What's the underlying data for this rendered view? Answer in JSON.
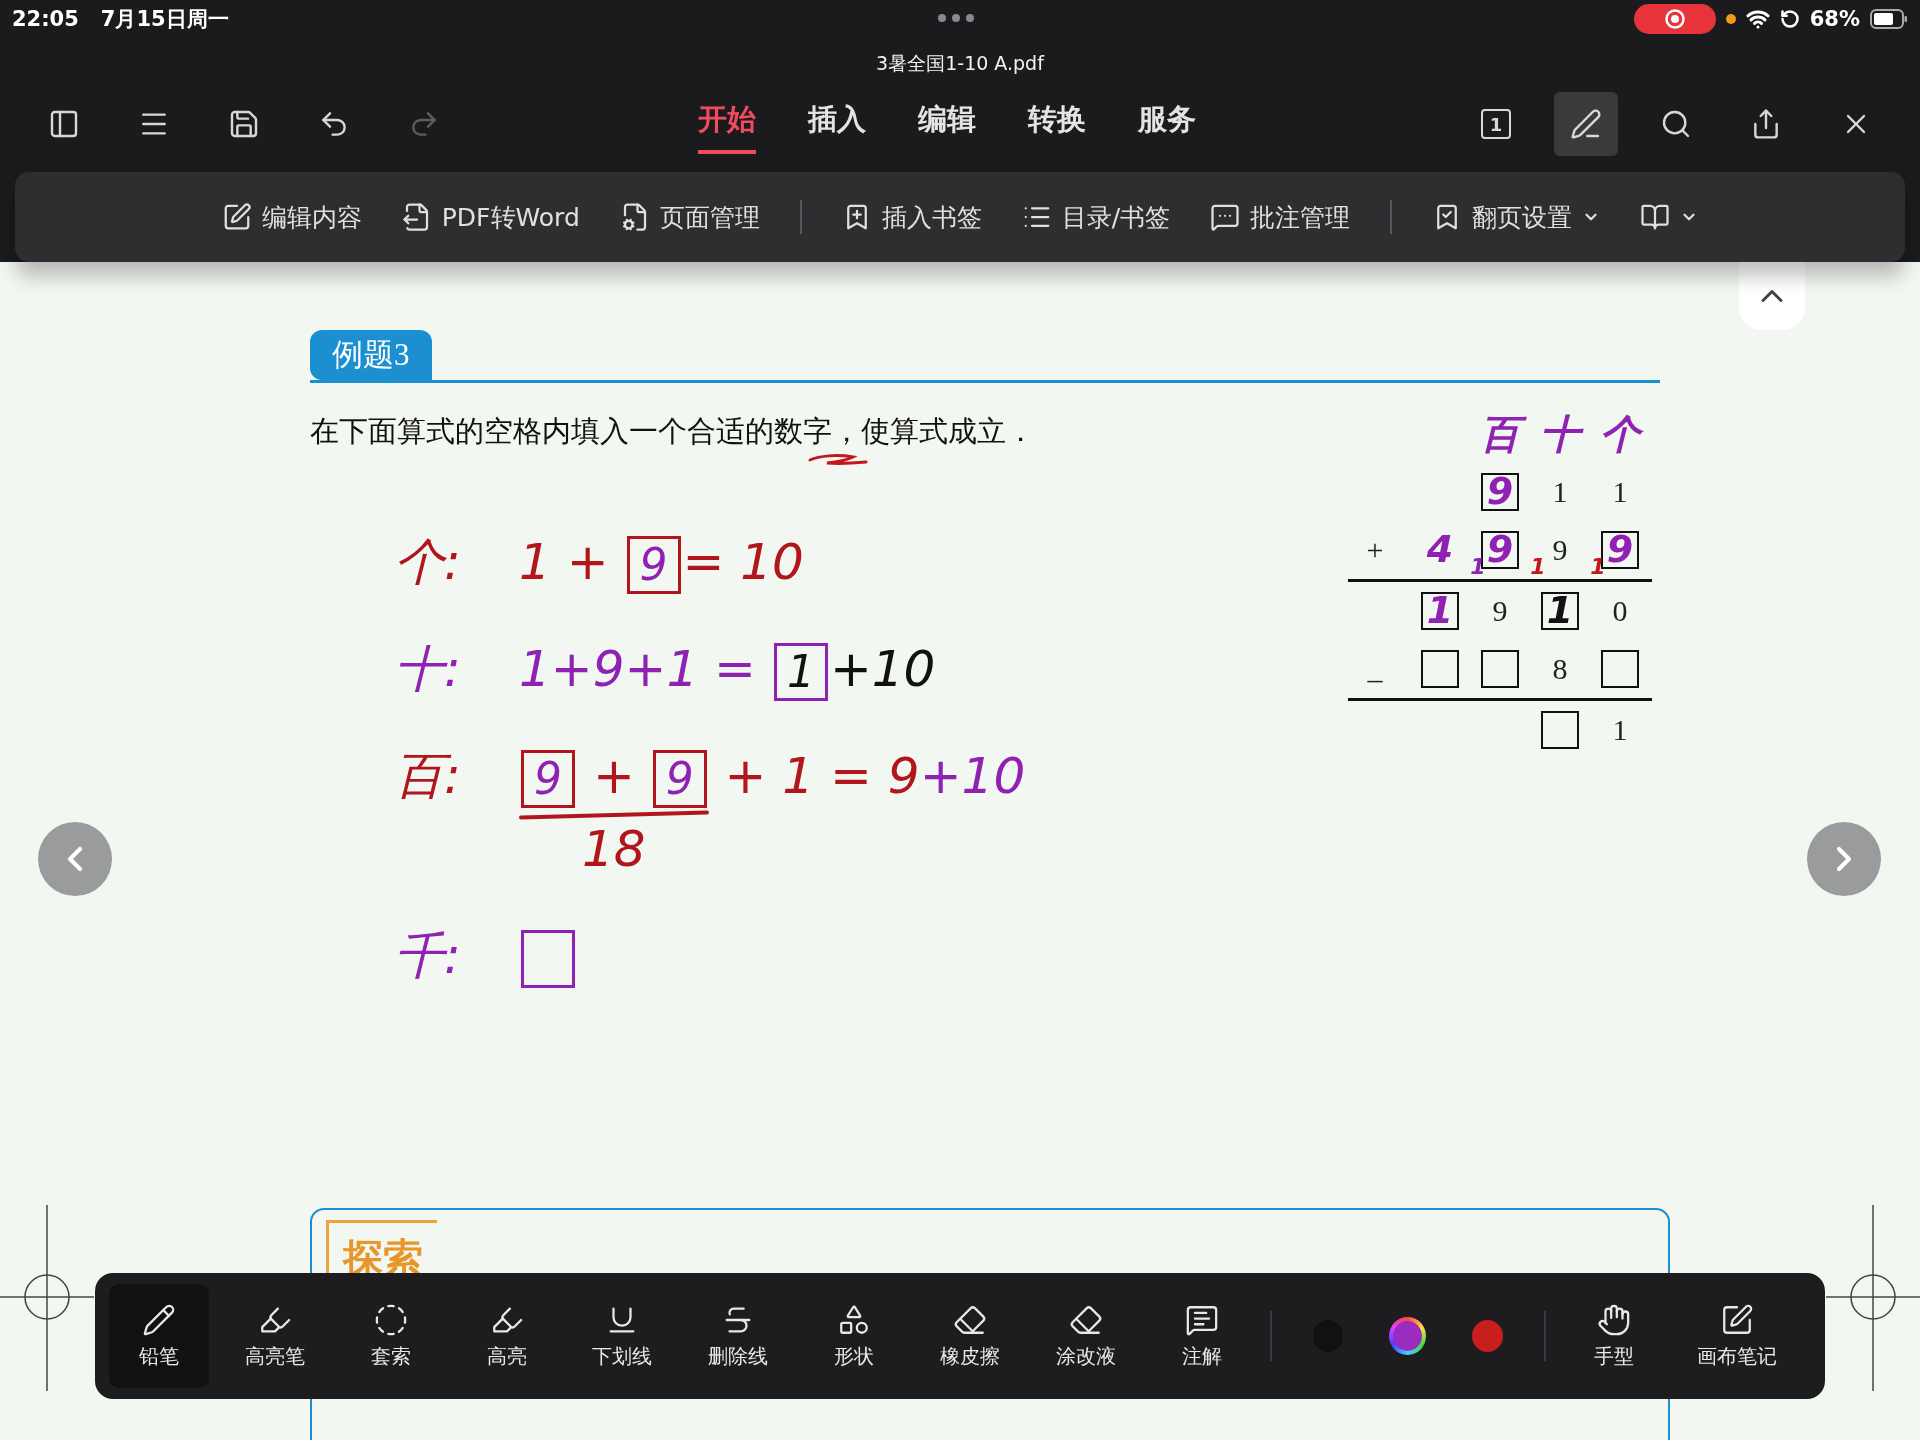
{
  "status_bar": {
    "time": "22:05",
    "date": "7月15日周一",
    "battery": "68%"
  },
  "window": {
    "title": "3暑全国1-10 A.pdf"
  },
  "toolbar": {
    "left_tools": [
      {
        "disabled": false
      },
      {
        "disabled": false
      },
      {
        "disabled": false
      },
      {
        "disabled": false
      },
      {
        "disabled": true
      }
    ],
    "tabs": [
      {
        "label": "开始",
        "selected": true
      },
      {
        "label": "插入",
        "selected": false
      },
      {
        "label": "编辑",
        "selected": false
      },
      {
        "label": "转换",
        "selected": false
      },
      {
        "label": "服务",
        "selected": false
      }
    ],
    "right_tools": [
      {
        "label": "1",
        "selected": false
      },
      {
        "selected": true
      },
      {
        "selected": false
      },
      {
        "selected": false
      },
      {
        "selected": false
      }
    ]
  },
  "ribbon": [
    [
      {
        "label": "编辑内容",
        "dropdown": false
      },
      {
        "label": "PDF转Word",
        "dropdown": false
      },
      {
        "label": "页面管理",
        "dropdown": false
      }
    ],
    [
      {
        "label": "插入书签",
        "dropdown": false
      },
      {
        "label": "目录/书签",
        "dropdown": false
      },
      {
        "label": "批注管理",
        "dropdown": false
      }
    ],
    [
      {
        "label": "翻页设置",
        "dropdown": true
      },
      {
        "dropdown": true
      }
    ]
  ],
  "document": {
    "badge": "例题3",
    "question": "在下面算式的空格内填入一个合适的数字，使算式成立．",
    "question_mark": {
      "color": "#c0181c"
    },
    "work": [
      {
        "label": {
          "text": "个:",
          "color": "#b0161b"
        },
        "segments": [
          {
            "kind": "ink",
            "text": "1 + ",
            "color": "#b0161b"
          },
          {
            "kind": "boxed",
            "text": "9",
            "color": "#8f22b3",
            "box": {
              "color": "#b0161b"
            }
          },
          {
            "kind": "ink",
            "text": "= 10",
            "color": "#b0161b"
          }
        ]
      },
      {
        "label": {
          "text": "十:",
          "color": "#8f22b3"
        },
        "segments": [
          {
            "kind": "ink",
            "text": "1+9+1 = ",
            "color": "#8f22b3"
          },
          {
            "kind": "boxed",
            "text": "1",
            "color": "#111111",
            "box": {
              "color": "#8f22b3"
            }
          },
          {
            "kind": "ink",
            "text": "+10",
            "color": "#111111"
          }
        ]
      },
      {
        "label": {
          "text": "百:",
          "color": "#b0161b"
        },
        "segments": [
          {
            "kind": "sum",
            "total": "18",
            "color": "#b0161b",
            "parts": [
              {
                "kind": "boxed",
                "text": "9",
                "color": "#8f22b3",
                "box": {
                  "color": "#b0161b"
                }
              },
              {
                "kind": "ink",
                "text": " + ",
                "color": "#b0161b"
              },
              {
                "kind": "boxed",
                "text": "9",
                "color": "#8f22b3",
                "box": {
                  "color": "#b0161b"
                }
              }
            ]
          },
          {
            "kind": "ink",
            "text": " + 1 = 9",
            "color": "#b0161b"
          },
          {
            "kind": "ink",
            "text": "+10",
            "color": "#8f22b3"
          }
        ]
      },
      {
        "label": {
          "text": "千:",
          "color": "#8f22b3"
        },
        "segments": [
          {
            "kind": "boxed",
            "box": {
              "color": "#8f22b3"
            }
          }
        ]
      }
    ],
    "arithmetic": {
      "header": [
        {
          "text": "百",
          "color": "#8f22b3"
        },
        {
          "text": "十",
          "color": "#8f22b3"
        },
        {
          "text": "个",
          "color": "#8f22b3"
        }
      ],
      "rows": [
        {
          "op": "",
          "cells": [
            {},
            {
              "boxed": true,
              "ink": "9",
              "color": "#8f22b3"
            },
            {
              "text": "1"
            },
            {
              "text": "1"
            }
          ]
        },
        {
          "op": "+",
          "cells": [
            {
              "ink": "4",
              "color": "#8f22b3"
            },
            {
              "boxed": true,
              "ink": "9",
              "color": "#8f22b3"
            },
            {
              "text": "9"
            },
            {
              "boxed": true,
              "ink": "9",
              "color": "#8f22b3"
            }
          ]
        },
        {
          "rule": true,
          "carries": [
            {
              "text": "1",
              "color": "#8f22b3"
            },
            {
              "text": "1",
              "color": "#c0181c"
            },
            {
              "text": "1",
              "color": "#c0181c"
            }
          ]
        },
        {
          "op": "",
          "cells": [
            {
              "boxed": true,
              "ink": "1",
              "color": "#8f22b3"
            },
            {
              "text": "9"
            },
            {
              "boxed": true,
              "ink": "1",
              "color": "#111111"
            },
            {
              "text": "0"
            }
          ]
        },
        {
          "op": "_",
          "cells": [
            {
              "boxed": true
            },
            {
              "boxed": true
            },
            {
              "text": "8"
            },
            {
              "boxed": true
            }
          ]
        },
        {
          "rule": true
        },
        {
          "op": "",
          "cells": [
            {},
            {},
            {
              "boxed": true
            },
            {
              "text": "1"
            }
          ]
        }
      ]
    },
    "next_section": "探索"
  },
  "annotation_bar": {
    "tools": [
      {
        "label": "铅笔",
        "selected": true
      },
      {
        "label": "高亮笔",
        "selected": false
      },
      {
        "label": "套索",
        "selected": false
      },
      {
        "label": "高亮",
        "selected": false
      },
      {
        "label": "下划线",
        "selected": false
      },
      {
        "label": "删除线",
        "selected": false
      },
      {
        "label": "形状",
        "selected": false
      },
      {
        "label": "橡皮擦",
        "selected": false
      },
      {
        "label": "涂改液",
        "selected": false
      },
      {
        "label": "注解",
        "selected": false
      }
    ],
    "colors": [
      {
        "color": "#111111",
        "selected": false
      },
      {
        "color": "#9a2cc0",
        "selected": true
      },
      {
        "color": "#c81e1e",
        "selected": false
      }
    ],
    "extra_tools": [
      {
        "label": "手型"
      },
      {
        "label": "画布笔记"
      }
    ]
  }
}
